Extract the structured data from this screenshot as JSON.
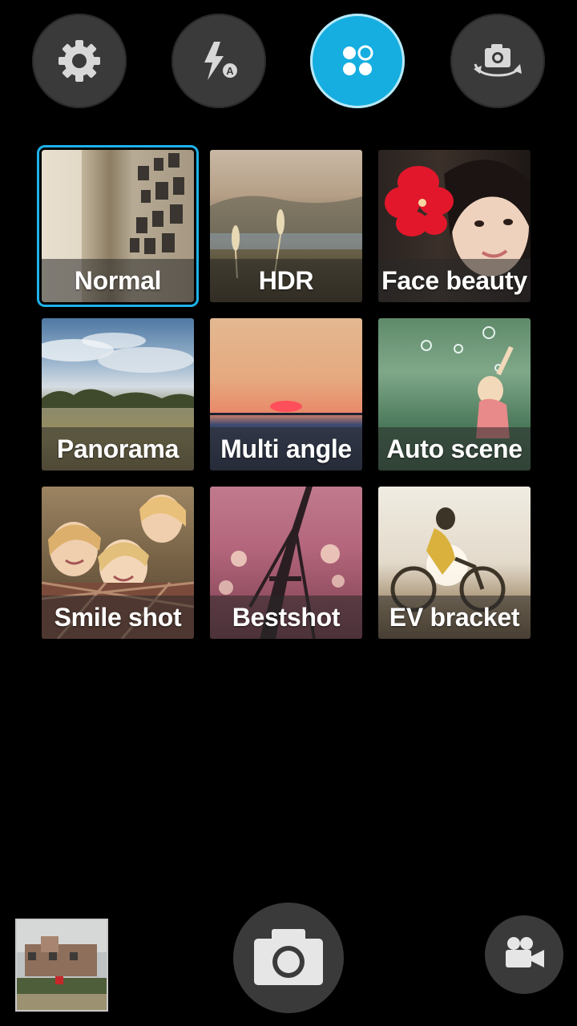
{
  "toolbar": {
    "settings_icon": "gear-icon",
    "flash_icon": "flash-auto-icon",
    "modes_icon": "camera-modes-icon",
    "switch_icon": "switch-camera-icon",
    "active_color": "#16aee0"
  },
  "modes": [
    {
      "label": "Normal",
      "selected": true
    },
    {
      "label": "HDR",
      "selected": false
    },
    {
      "label": "Face beauty",
      "selected": false
    },
    {
      "label": "Panorama",
      "selected": false
    },
    {
      "label": "Multi angle",
      "selected": false
    },
    {
      "label": "Auto scene",
      "selected": false
    },
    {
      "label": "Smile shot",
      "selected": false
    },
    {
      "label": "Bestshot",
      "selected": false
    },
    {
      "label": "EV bracket",
      "selected": false
    }
  ],
  "bottom": {
    "gallery_icon": "gallery-thumbnail",
    "shutter_icon": "camera-shutter-icon",
    "video_icon": "video-camera-icon"
  },
  "colors": {
    "selection": "#1fb2ea",
    "button_bg": "#3a3a3a"
  }
}
